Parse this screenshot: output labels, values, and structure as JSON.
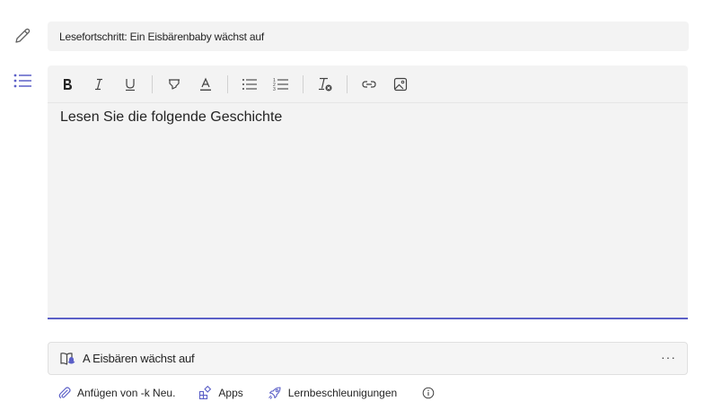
{
  "title_field": {
    "value": "Lesefortschritt: Ein Eisbärenbaby wächst auf"
  },
  "editor": {
    "content": "Lesen Sie die folgende Geschichte",
    "toolbar": [
      {
        "id": "bold",
        "icon": "bold-icon"
      },
      {
        "id": "italic",
        "icon": "italic-icon"
      },
      {
        "id": "underline",
        "icon": "underline-icon"
      },
      {
        "id": "highlight",
        "icon": "highlighter-icon"
      },
      {
        "id": "font-color",
        "icon": "font-color-icon"
      },
      {
        "id": "bullet-list",
        "icon": "bulleted-list-icon"
      },
      {
        "id": "numbered-list",
        "icon": "numbered-list-icon"
      },
      {
        "id": "clear-format",
        "icon": "clear-formatting-icon"
      },
      {
        "id": "link",
        "icon": "link-icon"
      },
      {
        "id": "image",
        "icon": "image-icon"
      }
    ],
    "accent_color": "#5b5fc7"
  },
  "attachment": {
    "name": "A  Eisbären wächst auf",
    "more": "···"
  },
  "footer": {
    "attach_label": "Anfügen von -k  Neu.",
    "apps_label": "Apps",
    "accelerators_label": "Lernbeschleunigungen",
    "info_icon": "info-icon"
  }
}
